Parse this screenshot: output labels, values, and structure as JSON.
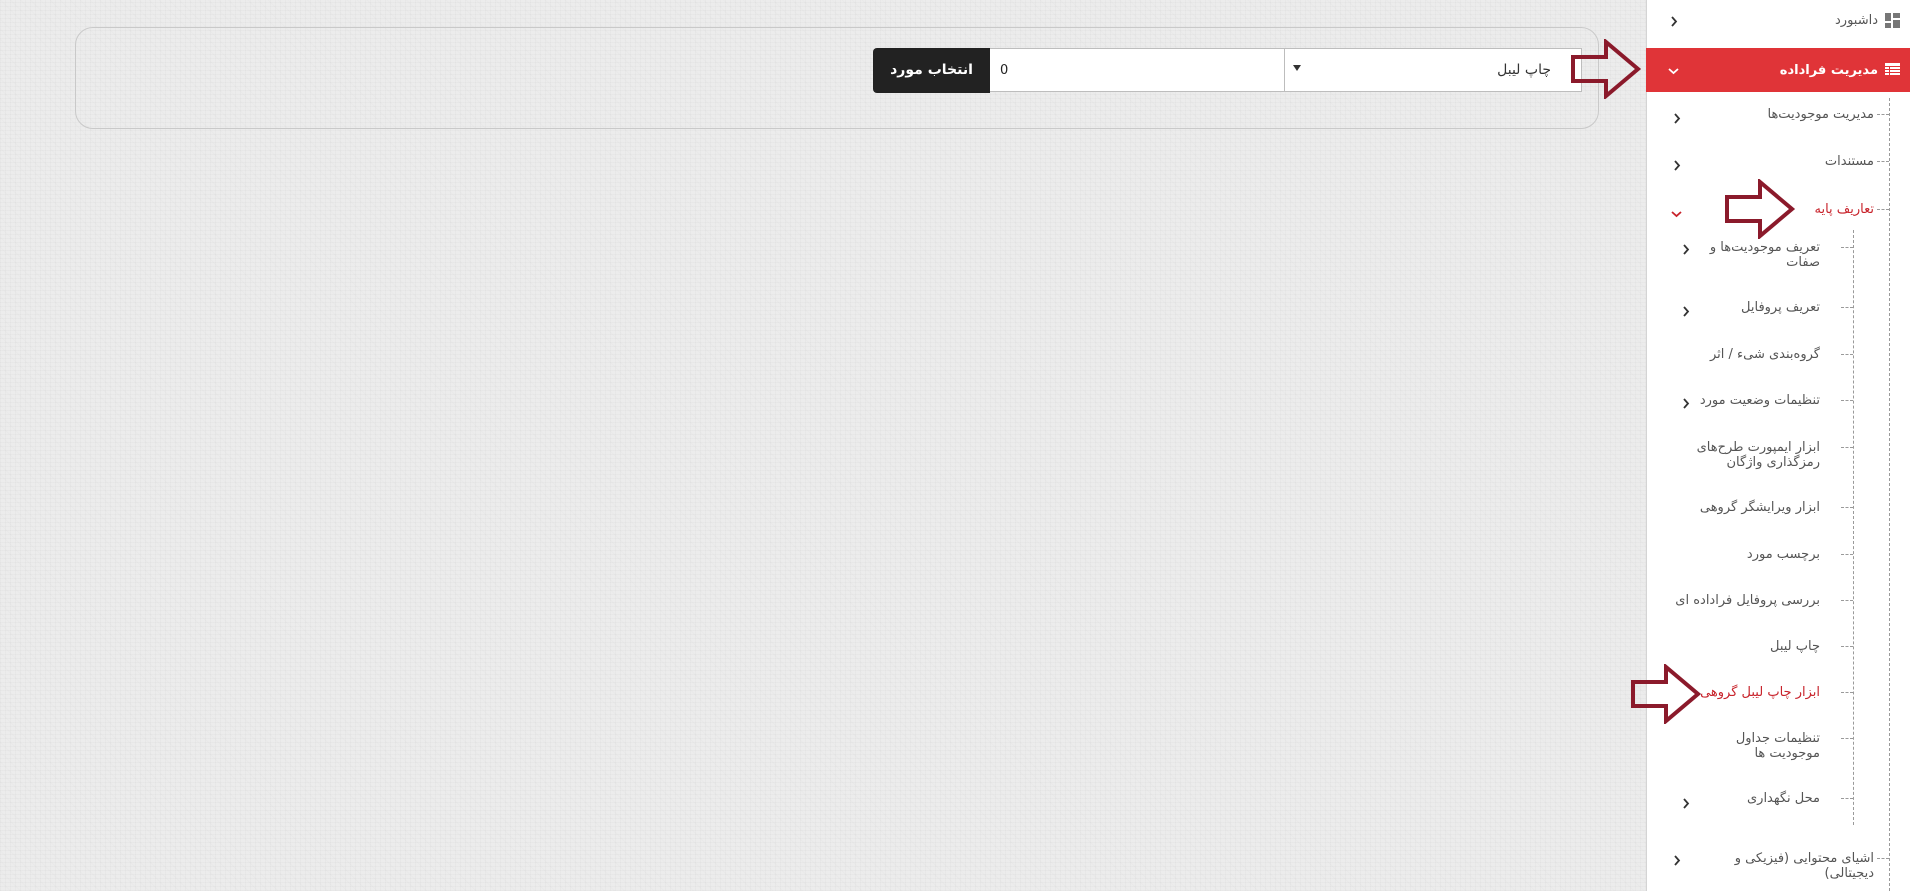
{
  "toolbar": {
    "select_value": "چاپ لیبل",
    "number_value": "0",
    "select_button_label": "انتخاب مورد"
  },
  "colors": {
    "accent": "#e03438",
    "active_text": "#c8232b",
    "arrow": "#8b1a2b",
    "button_dark": "#222222"
  },
  "sidebar": {
    "dashboard": {
      "label": "داشبورد",
      "icon": "dashboard-icon"
    },
    "contract_management": {
      "label": "مدیریت فرادادە",
      "icon": "table-icon",
      "expanded": true
    },
    "entity_management": "مدیریت موجودیت‌ها",
    "documents": "مستندات",
    "basic_definitions": {
      "label": "تعاریف پایه",
      "expanded": true
    },
    "sub_items": [
      {
        "label": "تعریف موجودیت‌ها و صفات",
        "has_children": true
      },
      {
        "label": "تعریف پروفایل",
        "has_children": true
      },
      {
        "label": "گروه‌بندی شیء / اثر",
        "has_children": false
      },
      {
        "label": "تنظیمات وضعیت مورد",
        "has_children": true
      },
      {
        "label": "ابزار ایمپورت طرح‌های رمزگذاری واژگان",
        "has_children": false
      },
      {
        "label": "ابزار ویرایشگر گروهی",
        "has_children": false
      },
      {
        "label": "برچسب مورد",
        "has_children": false
      },
      {
        "label": "بررسی پروفایل فرادادە ای",
        "has_children": false
      },
      {
        "label": "چاپ لیبل",
        "has_children": false
      },
      {
        "label": "ابزار چاپ لیبل گروهی",
        "has_children": false,
        "active": true
      },
      {
        "label": "تنظیمات جداول موجودیت ها",
        "has_children": false
      },
      {
        "label": "محل نگهداری",
        "has_children": true
      }
    ],
    "content_objects": "اشیای محتوایی (فیزیکی و دیجیتالی)"
  },
  "annotations": {
    "arrow_icon": "outline-arrow-right-icon"
  }
}
